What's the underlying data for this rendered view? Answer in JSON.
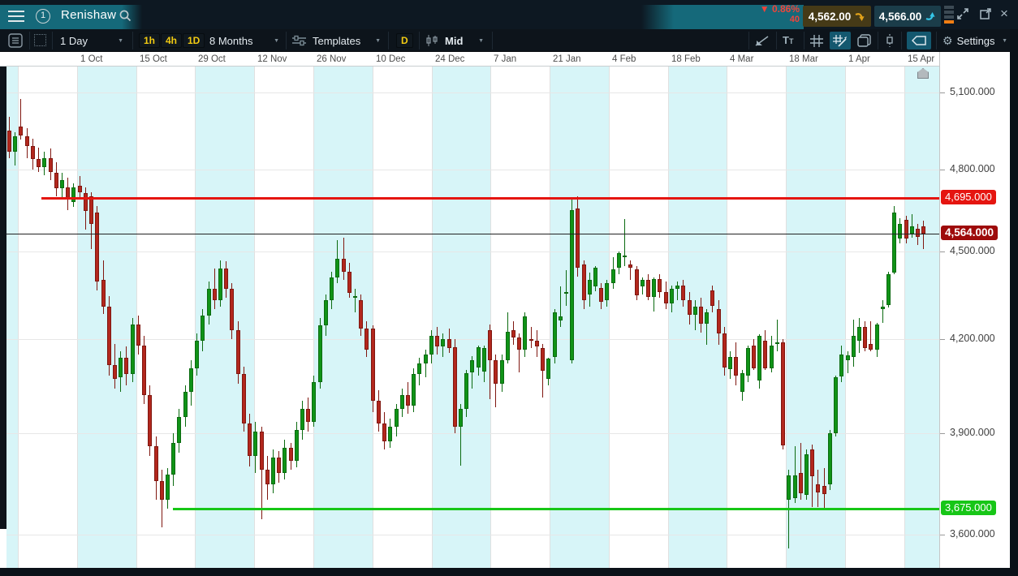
{
  "topbar": {
    "symbol": "Renishaw",
    "change_pct": "0.86%",
    "change_dir": "down",
    "spread": "40",
    "sell_price": "4,562.00",
    "buy_price": "4,566.00"
  },
  "toolbar": {
    "period": "1 Day",
    "timeframes": [
      "1h",
      "4h",
      "1D"
    ],
    "range": "8 Months",
    "templates_label": "Templates",
    "candle_period_badge": "D",
    "price_mode": "Mid",
    "settings_label": "Settings"
  },
  "icons": {
    "caret": "▼",
    "down_triangle": "▼",
    "gear": "⚙",
    "close": "×",
    "expand": "⤢"
  },
  "chart_data": {
    "type": "candlestick",
    "symbol": "Renishaw",
    "timeframe": "1 Day",
    "range": "8 Months",
    "x_tick_labels": [
      "1 Oct",
      "15 Oct",
      "29 Oct",
      "12 Nov",
      "26 Nov",
      "10 Dec",
      "24 Dec",
      "7 Jan",
      "21 Jan",
      "4 Feb",
      "18 Feb",
      "4 Mar",
      "18 Mar",
      "1 Apr",
      "15 Apr"
    ],
    "y_ticks": [
      5100,
      4800,
      4500,
      4200,
      3900,
      3600
    ],
    "y_axis_labels": [
      "5,100.000",
      "4,800.000",
      "4,500.000",
      "4,200.000",
      "3,900.000",
      "3,600.000"
    ],
    "ylim": [
      3500,
      5200
    ],
    "scale": "log",
    "grid": true,
    "levels": {
      "resistance": {
        "price": 4695,
        "label": "4,695.000",
        "color": "#e51510"
      },
      "current": {
        "price": 4564,
        "label": "4,564.000",
        "color": "#9e0a0a"
      },
      "support": {
        "price": 3675,
        "label": "3,675.000",
        "color": "#17c617"
      }
    },
    "colors": {
      "bull": "#109317",
      "bull_border": "#0b6b10",
      "bear": "#b2271d",
      "bear_border": "#801710",
      "band": "#d7f5f8"
    },
    "candles": [
      [
        4950,
        5005,
        4845,
        4870
      ],
      [
        4870,
        4945,
        4815,
        4930
      ],
      [
        4965,
        5075,
        4915,
        4930
      ],
      [
        4930,
        4960,
        4845,
        4890
      ],
      [
        4890,
        4920,
        4800,
        4840
      ],
      [
        4840,
        4885,
        4790,
        4810
      ],
      [
        4810,
        4870,
        4780,
        4845
      ],
      [
        4845,
        4880,
        4760,
        4790
      ],
      [
        4790,
        4830,
        4700,
        4730
      ],
      [
        4730,
        4790,
        4690,
        4760
      ],
      [
        4735,
        4770,
        4650,
        4690
      ],
      [
        4680,
        4750,
        4660,
        4735
      ],
      [
        4740,
        4775,
        4695,
        4715
      ],
      [
        4713,
        4735,
        4578,
        4645
      ],
      [
        4700,
        4715,
        4509,
        4600
      ],
      [
        4640,
        4665,
        4365,
        4395
      ],
      [
        4400,
        4470,
        4285,
        4310
      ],
      [
        4310,
        4345,
        4080,
        4115
      ],
      [
        4115,
        4185,
        4040,
        4070
      ],
      [
        4075,
        4160,
        4030,
        4140
      ],
      [
        4140,
        4175,
        4050,
        4085
      ],
      [
        4085,
        4270,
        4060,
        4250
      ],
      [
        4250,
        4280,
        4150,
        4180
      ],
      [
        4180,
        4210,
        3990,
        4020
      ],
      [
        4020,
        4050,
        3830,
        3860
      ],
      [
        3860,
        3890,
        3700,
        3755
      ],
      [
        3755,
        3790,
        3620,
        3700
      ],
      [
        3700,
        3795,
        3675,
        3775
      ],
      [
        3775,
        3900,
        3740,
        3870
      ],
      [
        3870,
        3975,
        3840,
        3950
      ],
      [
        3950,
        4050,
        3920,
        4030
      ],
      [
        4030,
        4130,
        3985,
        4105
      ],
      [
        4105,
        4220,
        4080,
        4195
      ],
      [
        4195,
        4300,
        4160,
        4280
      ],
      [
        4280,
        4395,
        4250,
        4370
      ],
      [
        4370,
        4440,
        4300,
        4330
      ],
      [
        4330,
        4470,
        4310,
        4440
      ],
      [
        4440,
        4465,
        4340,
        4370
      ],
      [
        4370,
        4390,
        4200,
        4230
      ],
      [
        4230,
        4260,
        4055,
        4085
      ],
      [
        4085,
        4110,
        3905,
        3930
      ],
      [
        3930,
        3960,
        3800,
        3830
      ],
      [
        3830,
        3935,
        3780,
        3905
      ],
      [
        3905,
        3920,
        3645,
        3790
      ],
      [
        3790,
        3830,
        3700,
        3745
      ],
      [
        3745,
        3850,
        3720,
        3825
      ],
      [
        3825,
        3845,
        3750,
        3780
      ],
      [
        3780,
        3880,
        3760,
        3855
      ],
      [
        3855,
        3870,
        3790,
        3815
      ],
      [
        3815,
        3935,
        3795,
        3910
      ],
      [
        3910,
        4000,
        3880,
        3975
      ],
      [
        3975,
        4010,
        3905,
        3935
      ],
      [
        3935,
        4080,
        3920,
        4060
      ],
      [
        4060,
        4270,
        4040,
        4245
      ],
      [
        4245,
        4350,
        4210,
        4330
      ],
      [
        4330,
        4430,
        4300,
        4410
      ],
      [
        4410,
        4540,
        4390,
        4475
      ],
      [
        4475,
        4550,
        4400,
        4430
      ],
      [
        4430,
        4460,
        4340,
        4355
      ],
      [
        4345,
        4370,
        4290,
        4345
      ],
      [
        4330,
        4350,
        4210,
        4235
      ],
      [
        4235,
        4260,
        4140,
        4165
      ],
      [
        4235,
        4245,
        3965,
        4000
      ],
      [
        4000,
        4035,
        3905,
        3930
      ],
      [
        3930,
        3965,
        3850,
        3875
      ],
      [
        3875,
        3945,
        3855,
        3920
      ],
      [
        3920,
        3990,
        3890,
        3975
      ],
      [
        3975,
        4040,
        3950,
        4020
      ],
      [
        4020,
        4060,
        3960,
        3985
      ],
      [
        3985,
        4105,
        3965,
        4085
      ],
      [
        4085,
        4140,
        4050,
        4120
      ],
      [
        4120,
        4165,
        4075,
        4150
      ],
      [
        4150,
        4230,
        4120,
        4210
      ],
      [
        4210,
        4240,
        4150,
        4175
      ],
      [
        4175,
        4220,
        4140,
        4200
      ],
      [
        4200,
        4235,
        4155,
        4170
      ],
      [
        4173,
        4200,
        3900,
        3920
      ],
      [
        3920,
        3990,
        3800,
        3975
      ],
      [
        3975,
        4100,
        3950,
        4090
      ],
      [
        4090,
        4145,
        4040,
        4130
      ],
      [
        4107,
        4180,
        4080,
        4173
      ],
      [
        4094,
        4180,
        4060,
        4171
      ],
      [
        4230,
        4250,
        4005,
        4130
      ],
      [
        4130,
        4150,
        3980,
        4055
      ],
      [
        4055,
        4150,
        4030,
        4130
      ],
      [
        4130,
        4290,
        4120,
        4225
      ],
      [
        4230,
        4260,
        4180,
        4205
      ],
      [
        4205,
        4220,
        4090,
        4165
      ],
      [
        4165,
        4290,
        4140,
        4275
      ],
      [
        4200,
        4240,
        4170,
        4195
      ],
      [
        4195,
        4230,
        4140,
        4175
      ],
      [
        4171,
        4185,
        4010,
        4096
      ],
      [
        4071,
        4140,
        4050,
        4136
      ],
      [
        4141,
        4300,
        4120,
        4291
      ],
      [
        4261,
        4379,
        4240,
        4277
      ],
      [
        4359,
        4435,
        4311,
        4359
      ],
      [
        4130,
        4695,
        4120,
        4651
      ],
      [
        4657,
        4700,
        4412,
        4443
      ],
      [
        4455,
        4470,
        4300,
        4331
      ],
      [
        4350,
        4425,
        4310,
        4400
      ],
      [
        4379,
        4450,
        4360,
        4443
      ],
      [
        4373,
        4390,
        4300,
        4325
      ],
      [
        4331,
        4400,
        4310,
        4389
      ],
      [
        4389,
        4481,
        4370,
        4437
      ],
      [
        4443,
        4500,
        4420,
        4494
      ],
      [
        4486,
        4616,
        4449,
        4486
      ],
      [
        4456,
        4470,
        4400,
        4443
      ],
      [
        4437,
        4450,
        4330,
        4348
      ],
      [
        4379,
        4410,
        4350,
        4401
      ],
      [
        4401,
        4420,
        4330,
        4341
      ],
      [
        4341,
        4410,
        4291,
        4405
      ],
      [
        4405,
        4420,
        4340,
        4360
      ],
      [
        4360,
        4395,
        4300,
        4320
      ],
      [
        4320,
        4380,
        4290,
        4370
      ],
      [
        4370,
        4395,
        4330,
        4380
      ],
      [
        4380,
        4400,
        4310,
        4330
      ],
      [
        4330,
        4360,
        4250,
        4280
      ],
      [
        4280,
        4330,
        4230,
        4310
      ],
      [
        4310,
        4340,
        4220,
        4250
      ],
      [
        4250,
        4300,
        4180,
        4290
      ],
      [
        4364,
        4380,
        4290,
        4311
      ],
      [
        4302,
        4330,
        4180,
        4220
      ],
      [
        4220,
        4240,
        4080,
        4108
      ],
      [
        4102,
        4160,
        4071,
        4141
      ],
      [
        4141,
        4190,
        4050,
        4080
      ],
      [
        4030,
        4100,
        4000,
        4090
      ],
      [
        4080,
        4180,
        4060,
        4170
      ],
      [
        4178,
        4200,
        4100,
        4104
      ],
      [
        4065,
        4215,
        4040,
        4210
      ],
      [
        4195,
        4230,
        4100,
        4105
      ],
      [
        4105,
        4210,
        4090,
        4180
      ],
      [
        4190,
        4265,
        4160,
        4190
      ],
      [
        4190,
        4200,
        3850,
        3862
      ],
      [
        3700,
        3790,
        3560,
        3772
      ],
      [
        3705,
        3860,
        3690,
        3772
      ],
      [
        3780,
        3870,
        3700,
        3720
      ],
      [
        3715,
        3850,
        3700,
        3835
      ],
      [
        3850,
        3865,
        3680,
        3770
      ],
      [
        3745,
        3790,
        3680,
        3722
      ],
      [
        3740,
        3795,
        3672,
        3718
      ],
      [
        3745,
        3910,
        3730,
        3900
      ],
      [
        3900,
        4080,
        3890,
        4075
      ],
      [
        4078,
        4180,
        4060,
        4150
      ],
      [
        4130,
        4160,
        4090,
        4148
      ],
      [
        4140,
        4265,
        4110,
        4210
      ],
      [
        4195,
        4270,
        4155,
        4240
      ],
      [
        4240,
        4260,
        4160,
        4170
      ],
      [
        4185,
        4260,
        4160,
        4165
      ],
      [
        4165,
        4255,
        4140,
        4250
      ],
      [
        4300,
        4330,
        4255,
        4310
      ],
      [
        4315,
        4430,
        4305,
        4420
      ],
      [
        4425,
        4665,
        4420,
        4640
      ],
      [
        4548,
        4620,
        4530,
        4600
      ],
      [
        4613,
        4630,
        4530,
        4548
      ],
      [
        4565,
        4635,
        4548,
        4592
      ],
      [
        4581,
        4600,
        4522,
        4551
      ],
      [
        4590,
        4610,
        4510,
        4564
      ]
    ]
  }
}
